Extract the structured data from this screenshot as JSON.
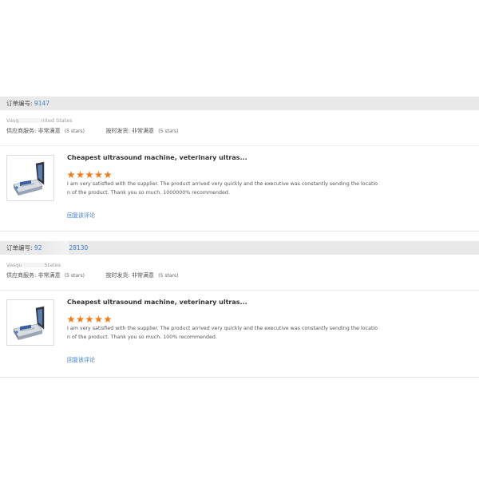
{
  "reviews": [
    {
      "order_label": "订单编号:",
      "order_number": "9147",
      "buyer_prefix": "Vasq",
      "buyer_suffix": "nited States",
      "supplier_service_label": "供应商服务:",
      "supplier_service_value": "非常满意",
      "supplier_service_stars": "(5 stars)",
      "on_time_label": "按时发货:",
      "on_time_value": "非常满意",
      "on_time_stars": "(5 stars)",
      "product_title": "Cheapest ultrasound machine, veterinary ultras...",
      "rating": 5,
      "comment": "I am very satisfied with the supplier. The product arrived very quickly and the executive was constantly sending the location of the product. Thank you so much. 1000000% recommended.",
      "reply_label": "回复该评论"
    },
    {
      "order_label": "订单编号:",
      "order_number_prefix": "92",
      "order_number_suffix": "28130",
      "buyer_prefix": "Vasqu",
      "buyer_suffix": "States",
      "supplier_service_label": "供应商服务:",
      "supplier_service_value": "非常满意",
      "supplier_service_stars": "(5 stars)",
      "on_time_label": "按时发货:",
      "on_time_value": "非常满意",
      "on_time_stars": "(5 stars)",
      "product_title": "Cheapest ultrasound machine, veterinary ultras...",
      "rating": 5,
      "comment": "I am very satisfied with the supplier. The product arrived very quickly and the executive was constantly sending the location of the product. Thank you so much. 100% recommended.",
      "reply_label": "回复该评论"
    }
  ],
  "colors": {
    "link": "#3a7bd5",
    "star": "#f07a1a",
    "bar": "#e9e9e9"
  },
  "icons": {
    "star": "star-icon",
    "product": "ultrasound-machine-image"
  }
}
